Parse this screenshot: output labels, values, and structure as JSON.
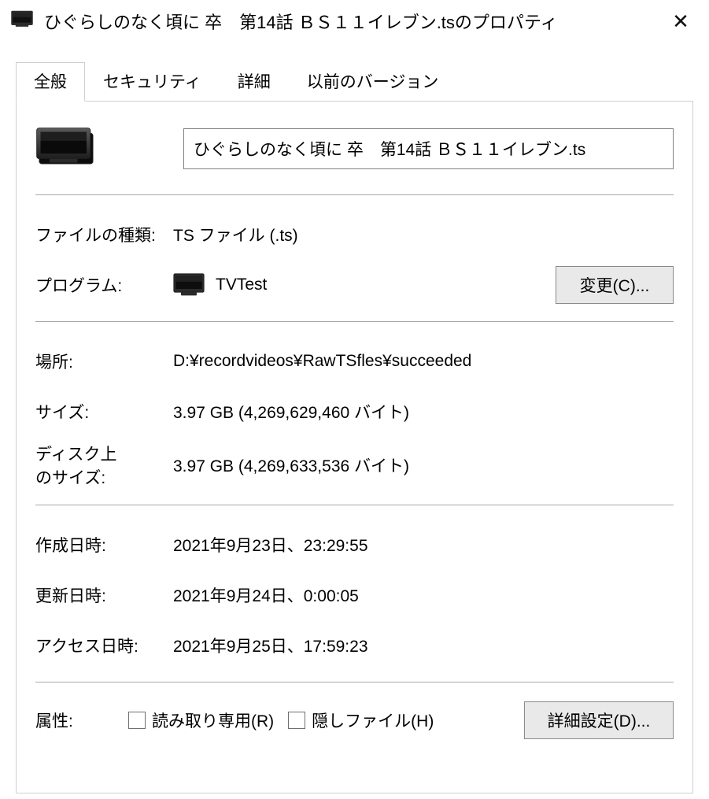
{
  "window": {
    "title": "ひぐらしのなく頃に 卒　第14話  ＢＳ１１イレブン.tsのプロパティ",
    "close_glyph": "✕"
  },
  "tabs": {
    "general": "全般",
    "security": "セキュリティ",
    "details": "詳細",
    "previous": "以前のバージョン"
  },
  "file": {
    "name": "ひぐらしのなく頃に 卒　第14話  ＢＳ１１イレブン.ts"
  },
  "fields": {
    "filetype_label": "ファイルの種類:",
    "filetype_value": "TS ファイル (.ts)",
    "program_label": "プログラム:",
    "program_value": "TVTest",
    "change_button": "変更(C)...",
    "location_label": "場所:",
    "location_value": "D:¥recordvideos¥RawTSfles¥succeeded",
    "size_label": "サイズ:",
    "size_value": "3.97 GB (4,269,629,460 バイト)",
    "sizeondisk_label": "ディスク上\nのサイズ:",
    "sizeondisk_value": "3.97 GB (4,269,633,536 バイト)",
    "created_label": "作成日時:",
    "created_value": "2021年9月23日、23:29:55",
    "modified_label": "更新日時:",
    "modified_value": "2021年9月24日、0:00:05",
    "accessed_label": "アクセス日時:",
    "accessed_value": "2021年9月25日、17:59:23",
    "attributes_label": "属性:",
    "readonly_label": "読み取り専用(R)",
    "hidden_label": "隠しファイル(H)",
    "advanced_button": "詳細設定(D)..."
  }
}
